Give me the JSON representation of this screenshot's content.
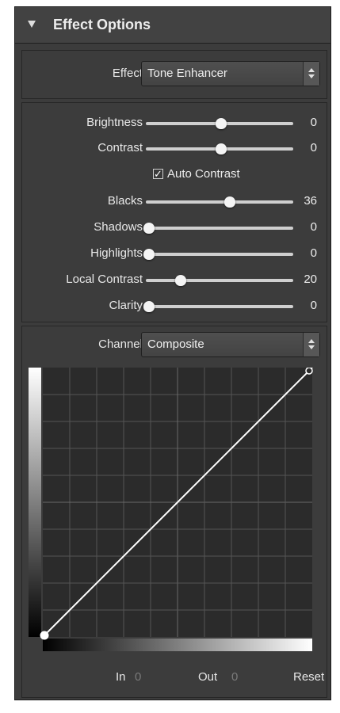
{
  "panel": {
    "title": "Effect Options"
  },
  "effect": {
    "label": "Effect",
    "value": "Tone Enhancer"
  },
  "sliders": [
    {
      "label": "Brightness",
      "value": "0",
      "level": 0.5
    },
    {
      "label": "Contrast",
      "value": "0",
      "level": 0.5
    },
    {
      "label": "Blacks",
      "value": "36",
      "level": 0.56
    },
    {
      "label": "Shadows",
      "value": "0",
      "level": 0.0
    },
    {
      "label": "Highlights",
      "value": "0",
      "level": 0.0
    },
    {
      "label": "Local Contrast",
      "value": "20",
      "level": 0.22
    },
    {
      "label": "Clarity",
      "value": "0",
      "level": 0.0
    }
  ],
  "auto_contrast": {
    "label": "Auto Contrast",
    "checked": true
  },
  "channel": {
    "label": "Channel",
    "value": "Composite"
  },
  "curve": {
    "points": [
      [
        0,
        0
      ],
      [
        255,
        255
      ]
    ]
  },
  "footer": {
    "in_label": "In",
    "in_value": "0",
    "out_label": "Out",
    "out_value": "0",
    "reset_label": "Reset"
  },
  "colors": {
    "panel_bg": "#3c3c3c",
    "curve_bg": "#2b2b2b",
    "grid": "#555555",
    "line": "#ffffff"
  }
}
